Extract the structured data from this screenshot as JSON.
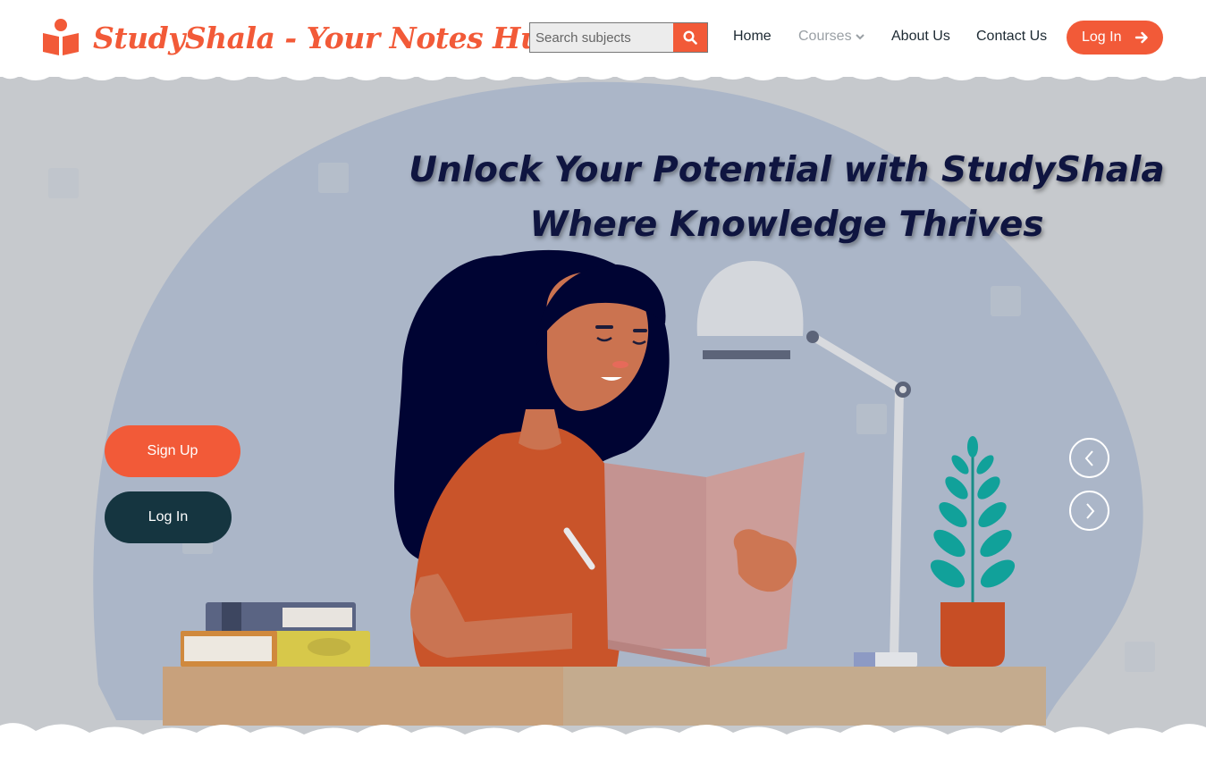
{
  "brand": {
    "name": "StudyShala - Your Notes Hub",
    "icon": "reader-icon"
  },
  "search": {
    "placeholder": "Search subjects",
    "value": "",
    "button_icon": "search-icon"
  },
  "nav": {
    "home": "Home",
    "courses": "Courses",
    "about": "About Us",
    "contact": "Contact Us",
    "login": "Log In"
  },
  "hero": {
    "headline_line1": "Unlock Your Potential with StudyShala",
    "headline_line2": "Where Knowledge Thrives",
    "signup": "Sign Up",
    "login": "Log In",
    "prev_icon": "chevron-left-icon",
    "next_icon": "chevron-right-icon"
  },
  "colors": {
    "accent": "#f25a38",
    "dark_button": "#153540",
    "headline": "#0f1540",
    "hero_bg": "#c6c9cd",
    "blob": "#abb6c8"
  }
}
